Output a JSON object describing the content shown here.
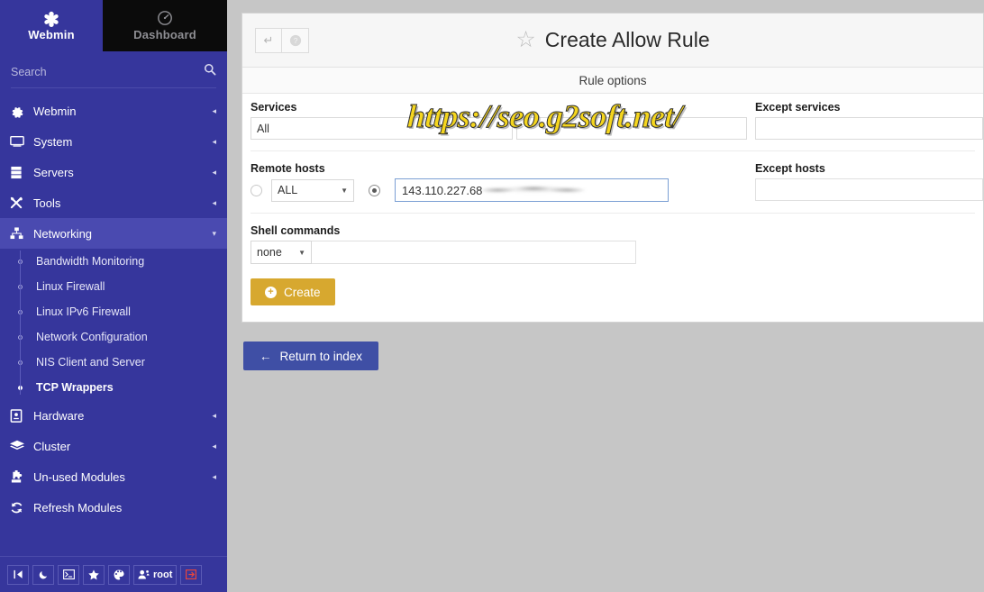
{
  "sidebar": {
    "brand": {
      "label": "Webmin",
      "icon": "webmin-logo-icon"
    },
    "dashboard": {
      "label": "Dashboard",
      "icon": "dashboard-gauge-icon"
    },
    "search": {
      "placeholder": "Search",
      "value": "",
      "icon": "search-icon"
    },
    "nav": [
      {
        "label": "Webmin",
        "icon": "gear-icon",
        "caret": "◂",
        "active": false
      },
      {
        "label": "System",
        "icon": "monitor-icon",
        "caret": "◂",
        "active": false
      },
      {
        "label": "Servers",
        "icon": "server-rack-icon",
        "caret": "◂",
        "active": false
      },
      {
        "label": "Tools",
        "icon": "tools-icon",
        "caret": "◂",
        "active": false
      },
      {
        "label": "Networking",
        "icon": "network-icon",
        "caret": "▾",
        "active": true
      }
    ],
    "sub_items": [
      {
        "label": "Bandwidth Monitoring",
        "selected": false
      },
      {
        "label": "Linux Firewall",
        "selected": false
      },
      {
        "label": "Linux IPv6 Firewall",
        "selected": false
      },
      {
        "label": "Network Configuration",
        "selected": false
      },
      {
        "label": "NIS Client and Server",
        "selected": false
      },
      {
        "label": "TCP Wrappers",
        "selected": true
      }
    ],
    "nav_bottom": [
      {
        "label": "Hardware",
        "icon": "hardware-chip-icon",
        "caret": "◂"
      },
      {
        "label": "Cluster",
        "icon": "layers-icon",
        "caret": "◂"
      },
      {
        "label": "Un-used Modules",
        "icon": "puzzle-icon",
        "caret": "◂"
      },
      {
        "label": "Refresh Modules",
        "icon": "refresh-icon",
        "caret": ""
      }
    ],
    "footer_buttons": [
      {
        "name": "collapse-sidebar-button",
        "glyph": "▐◀",
        "text": ""
      },
      {
        "name": "night-mode-button",
        "glyph": "☾",
        "text": ""
      },
      {
        "name": "terminal-button",
        "glyph": "⬛",
        "text": ""
      },
      {
        "name": "favorites-button",
        "glyph": "★",
        "text": ""
      },
      {
        "name": "theme-palette-button",
        "glyph": "◑",
        "text": ""
      },
      {
        "name": "user-button",
        "glyph": "☺",
        "text": "root"
      },
      {
        "name": "logout-button",
        "glyph": "→▐",
        "text": ""
      }
    ],
    "colors": {
      "bg": "#36369c",
      "active": "#4a4ab0",
      "dashboard_bg": "#0b0b0b"
    }
  },
  "header": {
    "back_button_glyph": "↵",
    "help_button_glyph": "?",
    "star_glyph": "☆",
    "title": "Create Allow Rule"
  },
  "form": {
    "section_title": "Rule options",
    "services": {
      "label": "Services",
      "value": "All"
    },
    "services_middle": {
      "value": ""
    },
    "except_services": {
      "label": "Except services",
      "value": ""
    },
    "remote_hosts": {
      "label": "Remote hosts",
      "radio_all_selected": false,
      "select_value": "ALL",
      "radio_custom_selected": true,
      "host_value": "143.110.227.68"
    },
    "except_hosts": {
      "label": "Except hosts",
      "value": ""
    },
    "shell_commands": {
      "label": "Shell commands",
      "select_value": "none",
      "value": ""
    },
    "create_button": {
      "label": "Create",
      "color": "#d7a82f"
    },
    "return_button": {
      "label": "Return to index",
      "color": "#3f4fa5",
      "arrow": "←"
    }
  },
  "watermark": {
    "text": "https://seo.g2soft.net/",
    "color": "#f5d61e"
  }
}
